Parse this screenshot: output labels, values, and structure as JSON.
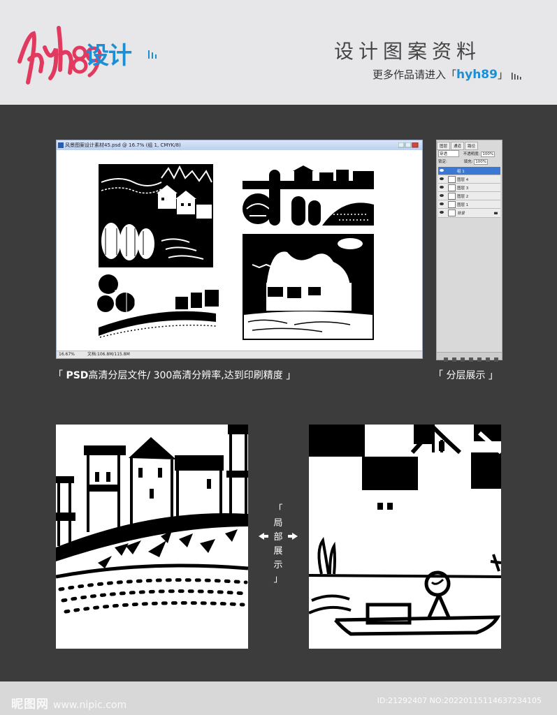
{
  "brand": {
    "logo_latin": "hyh89",
    "logo_cn": "设计"
  },
  "header": {
    "title": "设计图案资料",
    "subtitle_prefix": "更多作品请进入「",
    "subtitle_highlight": "hyh89",
    "subtitle_suffix": "」"
  },
  "psd_window": {
    "title": "风景图案设计素材45.psd @ 16.7% (组 1, CMYK/8)",
    "zoom": "16.67%",
    "doc": "文档:106.8M/115.8M"
  },
  "layers_panel": {
    "tabs": [
      "图层",
      "通道",
      "路径"
    ],
    "blend_mode": "穿透",
    "opacity_label": "不透明度:",
    "opacity_value": "100%",
    "lock_label": "锁定:",
    "fill_label": "填充:",
    "fill_value": "100%",
    "layers": [
      {
        "name": "组 1",
        "selected": true
      },
      {
        "name": "图层 4",
        "selected": false
      },
      {
        "name": "图层 3",
        "selected": false
      },
      {
        "name": "图层 2",
        "selected": false
      },
      {
        "name": "图层 1",
        "selected": false
      },
      {
        "name": "背景",
        "selected": false
      }
    ]
  },
  "captions": {
    "left_open": "「 ",
    "left_bold": "PSD",
    "left_rest": "高清分层文件/ 300高清分辨率,达到印刷精度 」",
    "right": "「 分层展示 」",
    "detail_lines": [
      "「",
      "局",
      "部",
      "展",
      "示",
      "」"
    ]
  },
  "footer": {
    "watermark_cn": "昵图网",
    "watermark_url": "www.nipic.com",
    "id_text": "ID:21292407 NO:20220115114637234105"
  },
  "colors": {
    "brand_pink": "#e2395f",
    "brand_blue": "#1b8fd6",
    "layer_selected": "#3a78d4"
  }
}
